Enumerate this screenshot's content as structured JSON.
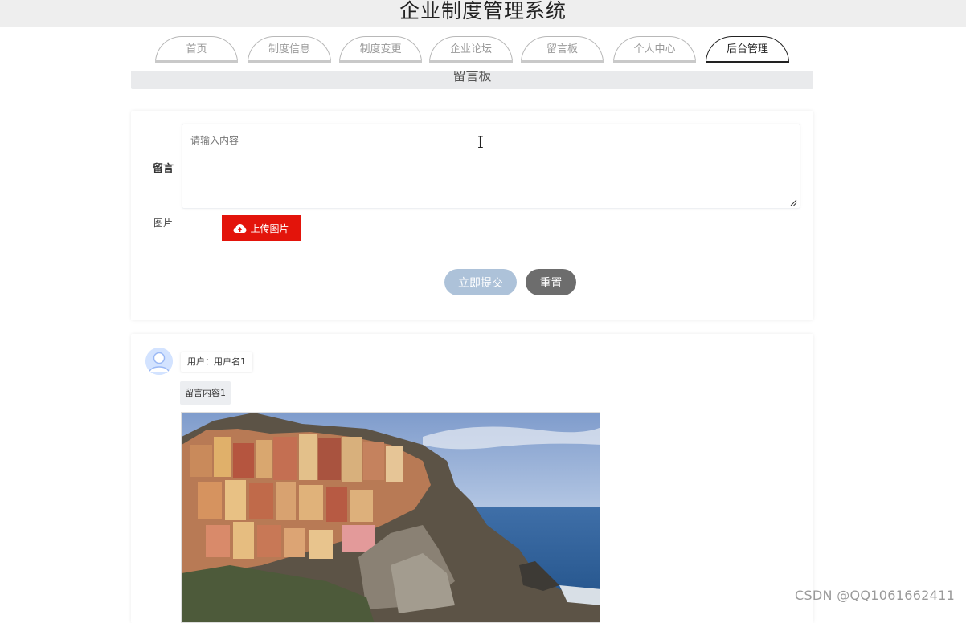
{
  "app": {
    "title": "企业制度管理系统"
  },
  "nav": {
    "tabs": [
      {
        "label": "首页"
      },
      {
        "label": "制度信息"
      },
      {
        "label": "制度变更"
      },
      {
        "label": "企业论坛"
      },
      {
        "label": "留言板"
      },
      {
        "label": "个人中心"
      },
      {
        "label": "后台管理"
      }
    ],
    "active_tab": "后台管理"
  },
  "section": {
    "title": "留言板"
  },
  "form": {
    "message_label": "留言",
    "message_placeholder": "请输入内容",
    "image_label": "图片",
    "upload_label": "上传图片",
    "submit_label": "立即提交",
    "reset_label": "重置"
  },
  "comments": [
    {
      "user": "用户：用户名1",
      "content": "留言内容1"
    }
  ],
  "watermark": "CSDN @QQ1061662411",
  "colors": {
    "upload": "#e3140b",
    "submit": "#adc2d9",
    "reset": "#6d6d6d"
  }
}
